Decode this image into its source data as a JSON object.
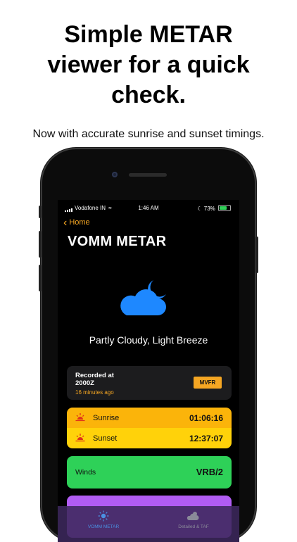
{
  "headline": "Simple METAR\nviewer for a quick\ncheck.",
  "subline": "Now with accurate sunrise and sunset timings.",
  "status_bar": {
    "carrier": "Vodafone IN",
    "time": "1:46 AM",
    "battery": "73%"
  },
  "nav": {
    "back_label": "Home"
  },
  "title": "VOMM METAR",
  "condition": {
    "text": "Partly Cloudy, Light Breeze",
    "icon": "cloud-moon-icon"
  },
  "recorded": {
    "label": "Recorded at\n2000Z",
    "ago": "16 minutes ago",
    "category": "MVFR"
  },
  "sun": {
    "sunrise_label": "Sunrise",
    "sunrise_time": "01:06:16",
    "sunset_label": "Sunset",
    "sunset_time": "12:37:07"
  },
  "winds": {
    "label": "Winds",
    "value": "VRB/2"
  },
  "tabs": [
    {
      "label": "VOMM METAR",
      "icon": "sun-icon",
      "active": true
    },
    {
      "label": "Detailed & TAF",
      "icon": "cloud-sun-icon",
      "active": false
    }
  ],
  "colors": {
    "accent": "#f5a623",
    "sunrise_bg": "#fbb40a",
    "sunset_bg": "#ffd20a",
    "winds_bg": "#2ed158",
    "purple_bg": "#b15cf3",
    "cloud": "#1e88ff",
    "tab_active": "#4a90e2"
  }
}
